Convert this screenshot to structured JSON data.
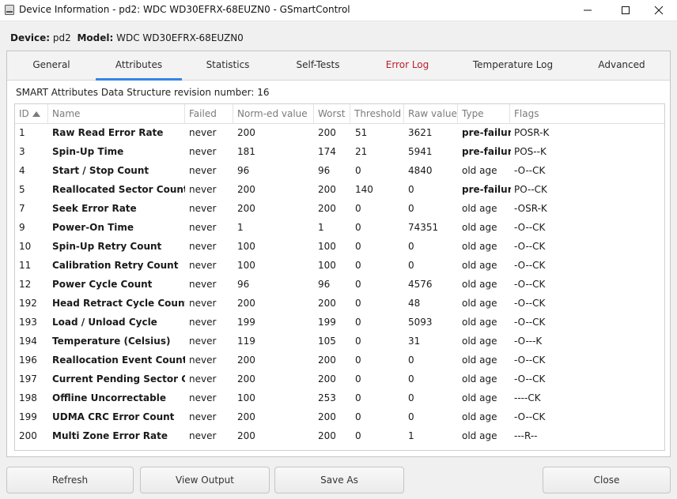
{
  "window": {
    "title": "Device Information - pd2: WDC WD30EFRX-68EUZN0 - GSmartControl"
  },
  "device": {
    "device_label": "Device:",
    "device_value": "pd2",
    "model_label": "Model:",
    "model_value": "WDC WD30EFRX-68EUZN0"
  },
  "tabs": [
    {
      "label": "General"
    },
    {
      "label": "Attributes"
    },
    {
      "label": "Statistics"
    },
    {
      "label": "Self-Tests"
    },
    {
      "label": "Error Log"
    },
    {
      "label": "Temperature Log"
    },
    {
      "label": "Advanced"
    }
  ],
  "active_tab": "Attributes",
  "colors": {
    "accent": "#3584e4",
    "error_tab": "#c01c28"
  },
  "attributes": {
    "revision_text": "SMART Attributes Data Structure revision number: 16",
    "columns": [
      "ID",
      "Name",
      "Failed",
      "Norm-ed value",
      "Worst",
      "Threshold",
      "Raw value",
      "Type",
      "Flags"
    ],
    "sorted_column": "ID",
    "rows": [
      {
        "id": "1",
        "name": "Raw Read Error Rate",
        "failed": "never",
        "value": "200",
        "worst": "200",
        "threshold": "51",
        "raw": "3621",
        "type": "pre-failure",
        "flags": "POSR-K"
      },
      {
        "id": "3",
        "name": "Spin-Up Time",
        "failed": "never",
        "value": "181",
        "worst": "174",
        "threshold": "21",
        "raw": "5941",
        "type": "pre-failure",
        "flags": "POS--K"
      },
      {
        "id": "4",
        "name": "Start / Stop Count",
        "failed": "never",
        "value": "96",
        "worst": "96",
        "threshold": "0",
        "raw": "4840",
        "type": "old age",
        "flags": "-O--CK"
      },
      {
        "id": "5",
        "name": "Reallocated Sector Count",
        "failed": "never",
        "value": "200",
        "worst": "200",
        "threshold": "140",
        "raw": "0",
        "type": "pre-failure",
        "flags": "PO--CK"
      },
      {
        "id": "7",
        "name": "Seek Error Rate",
        "failed": "never",
        "value": "200",
        "worst": "200",
        "threshold": "0",
        "raw": "0",
        "type": "old age",
        "flags": "-OSR-K"
      },
      {
        "id": "9",
        "name": "Power-On Time",
        "failed": "never",
        "value": "1",
        "worst": "1",
        "threshold": "0",
        "raw": "74351",
        "type": "old age",
        "flags": "-O--CK"
      },
      {
        "id": "10",
        "name": "Spin-Up Retry Count",
        "failed": "never",
        "value": "100",
        "worst": "100",
        "threshold": "0",
        "raw": "0",
        "type": "old age",
        "flags": "-O--CK"
      },
      {
        "id": "11",
        "name": "Calibration Retry Count",
        "failed": "never",
        "value": "100",
        "worst": "100",
        "threshold": "0",
        "raw": "0",
        "type": "old age",
        "flags": "-O--CK"
      },
      {
        "id": "12",
        "name": "Power Cycle Count",
        "failed": "never",
        "value": "96",
        "worst": "96",
        "threshold": "0",
        "raw": "4576",
        "type": "old age",
        "flags": "-O--CK"
      },
      {
        "id": "192",
        "name": "Head Retract Cycle Count",
        "failed": "never",
        "value": "200",
        "worst": "200",
        "threshold": "0",
        "raw": "48",
        "type": "old age",
        "flags": "-O--CK"
      },
      {
        "id": "193",
        "name": "Load / Unload Cycle",
        "failed": "never",
        "value": "199",
        "worst": "199",
        "threshold": "0",
        "raw": "5093",
        "type": "old age",
        "flags": "-O--CK"
      },
      {
        "id": "194",
        "name": "Temperature (Celsius)",
        "failed": "never",
        "value": "119",
        "worst": "105",
        "threshold": "0",
        "raw": "31",
        "type": "old age",
        "flags": "-O---K"
      },
      {
        "id": "196",
        "name": "Reallocation Event Count",
        "failed": "never",
        "value": "200",
        "worst": "200",
        "threshold": "0",
        "raw": "0",
        "type": "old age",
        "flags": "-O--CK"
      },
      {
        "id": "197",
        "name": "Current Pending Sector Count",
        "failed": "never",
        "value": "200",
        "worst": "200",
        "threshold": "0",
        "raw": "0",
        "type": "old age",
        "flags": "-O--CK"
      },
      {
        "id": "198",
        "name": "Offline Uncorrectable",
        "failed": "never",
        "value": "100",
        "worst": "253",
        "threshold": "0",
        "raw": "0",
        "type": "old age",
        "flags": "----CK"
      },
      {
        "id": "199",
        "name": "UDMA CRC Error Count",
        "failed": "never",
        "value": "200",
        "worst": "200",
        "threshold": "0",
        "raw": "0",
        "type": "old age",
        "flags": "-O--CK"
      },
      {
        "id": "200",
        "name": "Multi Zone Error Rate",
        "failed": "never",
        "value": "200",
        "worst": "200",
        "threshold": "0",
        "raw": "1",
        "type": "old age",
        "flags": "---R--"
      }
    ]
  },
  "buttons": {
    "refresh": "Refresh",
    "view_output": "View Output",
    "save_as": "Save As",
    "close": "Close"
  }
}
